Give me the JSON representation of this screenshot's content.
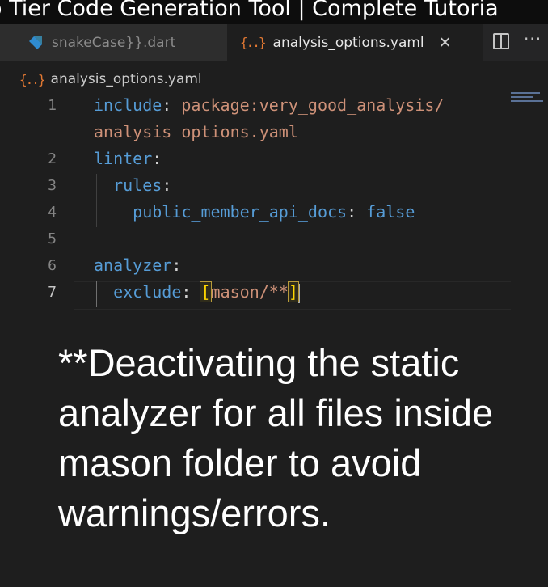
{
  "video": {
    "title": "o Tier Code Generation Tool | Complete Tutoria"
  },
  "tabs": [
    {
      "label": "snakeCase}}.dart",
      "icon": "dart-icon"
    },
    {
      "label": "analysis_options.yaml",
      "icon": "yaml-icon"
    }
  ],
  "editor_actions": {
    "split": "split-editor-icon",
    "more": "···"
  },
  "breadcrumb": {
    "file": "analysis_options.yaml"
  },
  "code": {
    "line1a": {
      "key": "include",
      "colon": ":",
      "value": " package:very_good_analysis/"
    },
    "line1b": {
      "value": "analysis_options.yaml"
    },
    "line2": {
      "key": "linter",
      "colon": ":"
    },
    "line3": {
      "key": "rules",
      "colon": ":"
    },
    "line4": {
      "key": "public_member_api_docs",
      "colon": ":",
      "value": " false"
    },
    "line6": {
      "key": "analyzer",
      "colon": ":"
    },
    "line7": {
      "key": "exclude",
      "colon": ":",
      "open": "[",
      "value": "mason/**",
      "close": "]"
    }
  },
  "line_numbers": [
    "1",
    "2",
    "3",
    "4",
    "5",
    "6",
    "7"
  ],
  "caption": "**Deactivating the static analyzer for all files inside mason folder to avoid warnings/errors.",
  "colors": {
    "key": "#569cd6",
    "string": "#ce9178",
    "bracket": "#ffd700",
    "yaml_icon": "#e37933"
  }
}
